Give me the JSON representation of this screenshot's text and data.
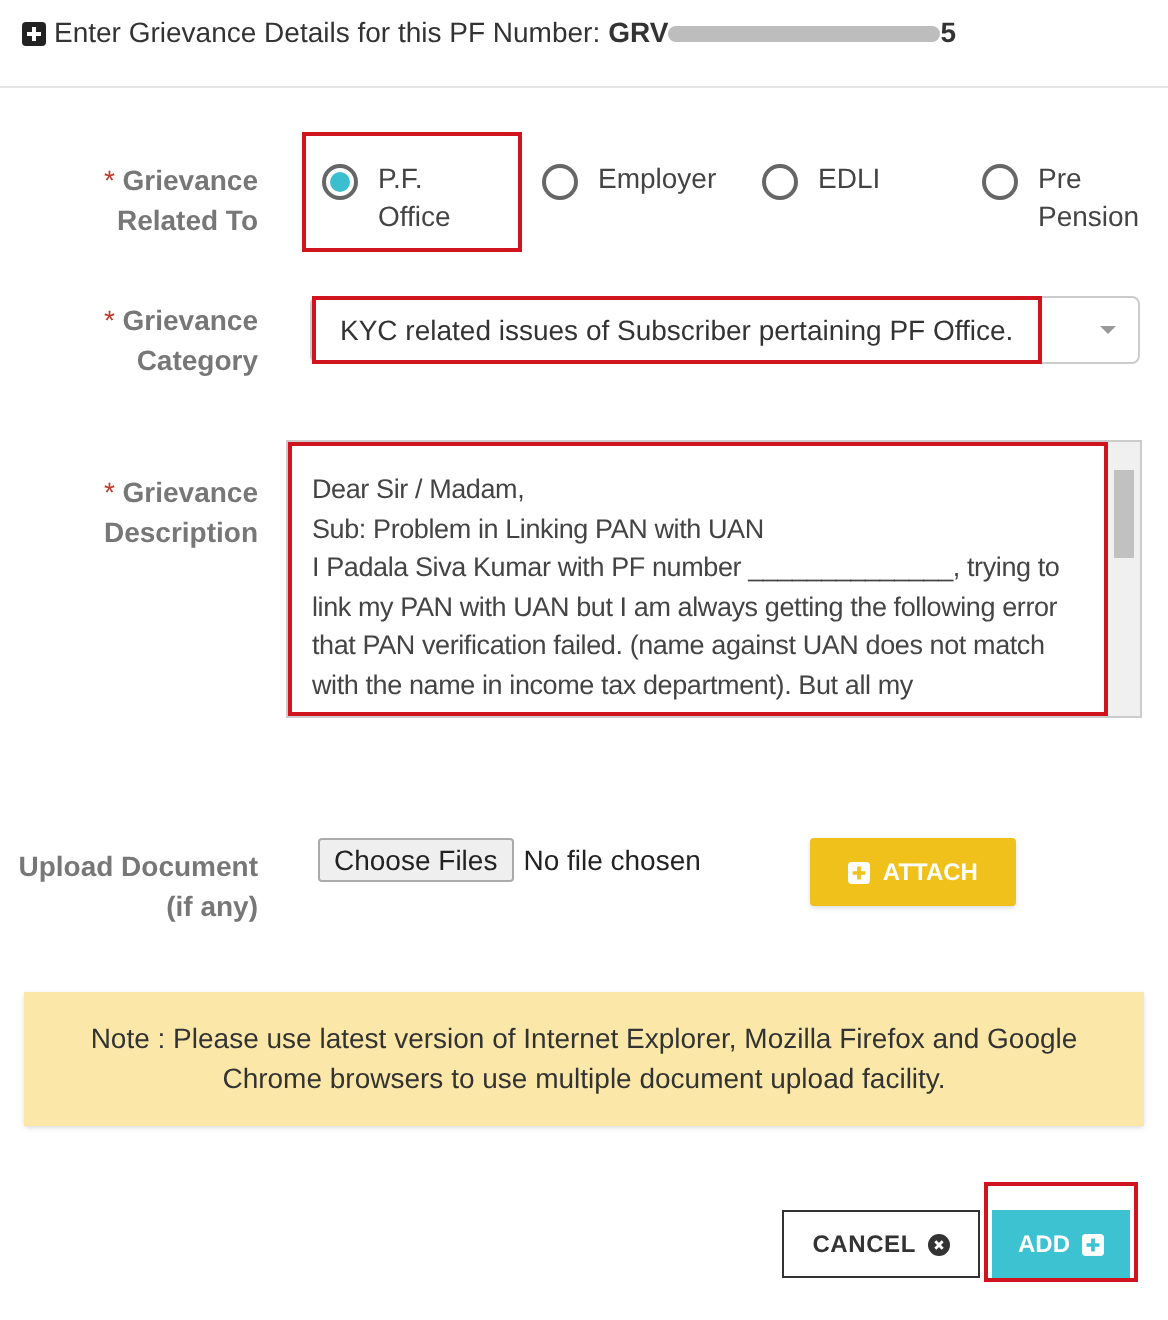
{
  "header": {
    "text": "Enter Grievance Details for this PF Number:",
    "pf_number_start": "GRV",
    "pf_number_end": "5"
  },
  "related_to": {
    "label": "Grievance Related To",
    "required_mark": "*",
    "options": [
      {
        "label": "P.F. Office",
        "selected": true,
        "highlighted": true
      },
      {
        "label": "Employer",
        "selected": false,
        "highlighted": false
      },
      {
        "label": "EDLI",
        "selected": false,
        "highlighted": false
      },
      {
        "label": "Pre Pension",
        "selected": false,
        "highlighted": false
      }
    ]
  },
  "category": {
    "label": "Grievance Category",
    "required_mark": "*",
    "value": "KYC related issues of Subscriber pertaining PF Office.",
    "highlighted": true
  },
  "description": {
    "label": "Grievance Description",
    "required_mark": "*",
    "highlighted": true,
    "lines": [
      "Dear Sir / Madam,",
      "Sub: Problem in Linking PAN with UAN",
      "I Padala Siva Kumar with PF number ______________, trying to link my PAN with UAN but I am always getting the following error that PAN verification failed. (name against UAN does not match with the name in income tax department). But all my"
    ]
  },
  "upload": {
    "label": "Upload Document (if any)",
    "choose_button": "Choose Files",
    "status": "No file chosen",
    "attach_button": "ATTACH"
  },
  "note": "Note : Please use latest version of Internet Explorer, Mozilla Firefox and Google Chrome browsers to use multiple document upload facility.",
  "buttons": [
    {
      "label": "CANCEL",
      "kind": "cancel",
      "highlighted": false
    },
    {
      "label": "ADD",
      "kind": "add",
      "highlighted": true
    }
  ]
}
